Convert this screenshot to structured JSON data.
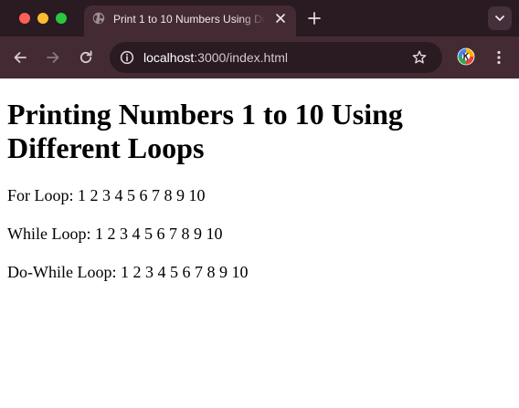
{
  "browser": {
    "tab": {
      "title": "Print 1 to 10 Numbers Using Different Loops",
      "close_icon": "close-icon",
      "favicon": "globe-icon"
    },
    "new_tab_icon": "plus-icon",
    "tab_search_icon": "chevron-down-icon",
    "toolbar": {
      "back_icon": "arrow-left-icon",
      "forward_icon": "arrow-right-icon",
      "reload_icon": "reload-icon",
      "site_info_icon": "info-icon",
      "url_host": "localhost",
      "url_rest": ":3000/index.html",
      "bookmark_icon": "star-icon",
      "profile_icon": "profile-icon",
      "menu_icon": "kebab-menu-icon"
    },
    "colors": {
      "tabstrip_bg": "#2a1a21",
      "toolbar_bg": "#442b33",
      "close_dot": "#ff5f57",
      "minimize_dot": "#febc2e",
      "maximize_dot": "#28c840"
    }
  },
  "page": {
    "heading": "Printing Numbers 1 to 10 Using Different Loops",
    "lines": [
      "For Loop: 1 2 3 4 5 6 7 8 9 10",
      "While Loop: 1 2 3 4 5 6 7 8 9 10",
      "Do-While Loop: 1 2 3 4 5 6 7 8 9 10"
    ]
  }
}
